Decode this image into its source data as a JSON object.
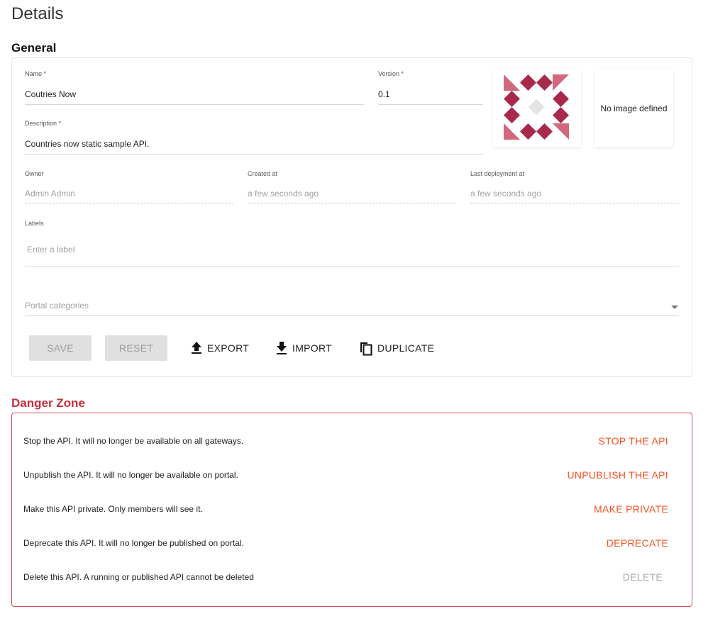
{
  "page": {
    "title": "Details"
  },
  "general": {
    "title": "General",
    "name": {
      "label": "Name *",
      "value": "Coutries Now"
    },
    "version": {
      "label": "Version *",
      "value": "0.1"
    },
    "description": {
      "label": "Description *",
      "value": "Countries now static sample API."
    },
    "owner": {
      "label": "Owner",
      "value": "Admin Admin"
    },
    "created_at": {
      "label": "Created at",
      "value": "a few seconds ago"
    },
    "last_deployment": {
      "label": "Last deployment at",
      "value": "a few seconds ago"
    },
    "labels": {
      "label": "Labels",
      "placeholder": "Enter a label"
    },
    "categories": {
      "placeholder": "Portal categories"
    },
    "picture": {
      "icon": "identicon-picture"
    },
    "background": {
      "text": "No image defined"
    },
    "actions": {
      "save": "SAVE",
      "reset": "RESET",
      "export": "EXPORT",
      "import": "IMPORT",
      "duplicate": "DUPLICATE"
    }
  },
  "danger_zone": {
    "title": "Danger Zone",
    "rows": [
      {
        "text": "Stop the API. It will no longer be available on all gateways.",
        "action": "STOP THE API",
        "enabled": true
      },
      {
        "text": "Unpublish the API. It will no longer be available on portal.",
        "action": "UNPUBLISH THE API",
        "enabled": true
      },
      {
        "text": "Make this API private. Only members will see it.",
        "action": "MAKE PRIVATE",
        "enabled": true
      },
      {
        "text": "Deprecate this API. It will no longer be published on portal.",
        "action": "DEPRECATE",
        "enabled": true
      },
      {
        "text": "Delete this API. A running or published API cannot be deleted",
        "action": "DELETE",
        "enabled": false
      }
    ]
  },
  "colors": {
    "accent": "#f4511e",
    "danger": "#c62e3e",
    "identicon_dark": "#a8294a",
    "identicon_light": "#d1687e",
    "identicon_center": "#e4e4e4"
  }
}
